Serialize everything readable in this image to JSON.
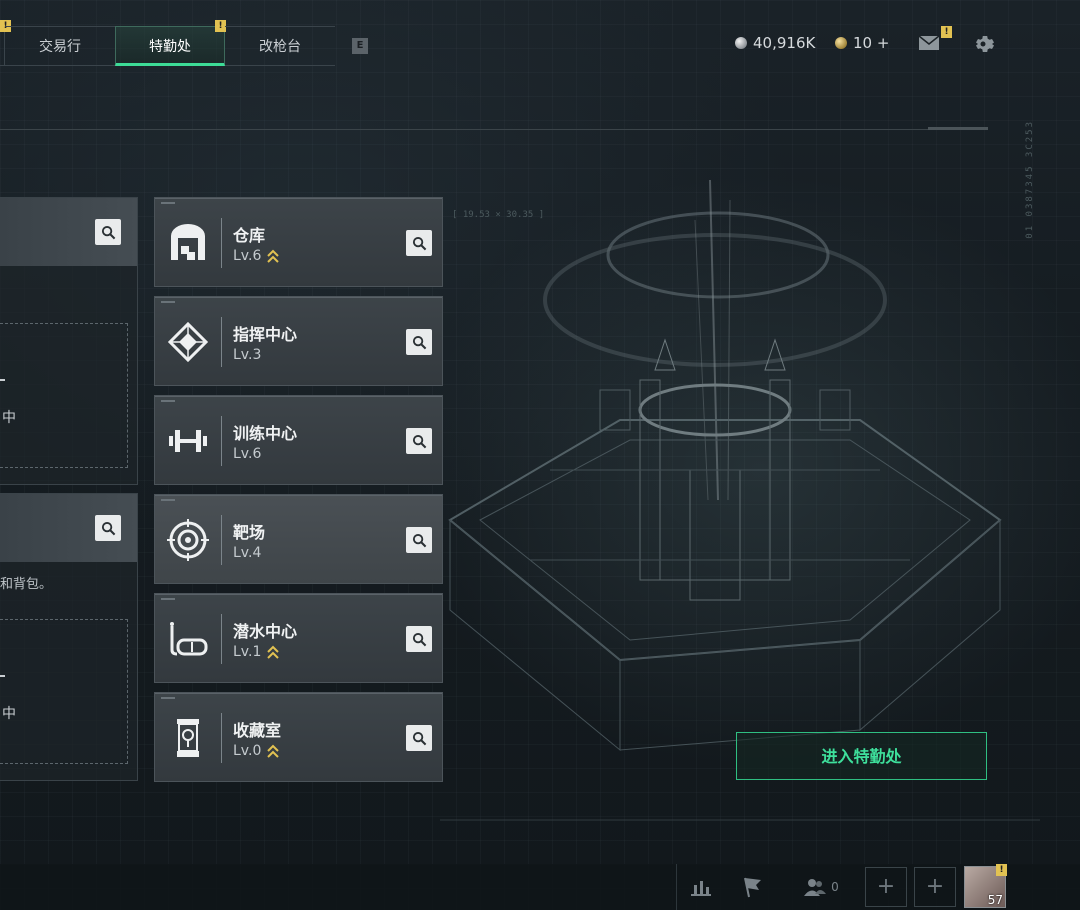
{
  "tabs": [
    {
      "label": "",
      "badge": "!"
    },
    {
      "label": "交易行",
      "badge": ""
    },
    {
      "label": "特勤处",
      "badge": "!",
      "active": true
    },
    {
      "label": "改枪台",
      "badge": ""
    }
  ],
  "key_hint": "E",
  "currency": {
    "silver": "40,916K",
    "gold": "10 +"
  },
  "mail_badge": "!",
  "left_cards": [
    {
      "slot_text": "中"
    },
    {
      "desc": "和背包。",
      "slot_text": "中"
    }
  ],
  "facilities": [
    {
      "name": "仓库",
      "level": "Lv.6",
      "upgradable": true,
      "icon": "warehouse-icon"
    },
    {
      "name": "指挥中心",
      "level": "Lv.3",
      "upgradable": false,
      "icon": "command-center-icon"
    },
    {
      "name": "训练中心",
      "level": "Lv.6",
      "upgradable": false,
      "icon": "dumbbell-icon"
    },
    {
      "name": "靶场",
      "level": "Lv.4",
      "upgradable": false,
      "icon": "target-icon",
      "selected": true
    },
    {
      "name": "潜水中心",
      "level": "Lv.1",
      "upgradable": true,
      "icon": "diving-mask-icon"
    },
    {
      "name": "收藏室",
      "level": "Lv.0",
      "upgradable": true,
      "icon": "collection-case-icon"
    }
  ],
  "coord_text": "[ 19.53 × 30.35 ]",
  "vert_text": "01 0387345 3C253",
  "enter_button": "进入特勤处",
  "bottom": {
    "friends_count": "0",
    "player_level": "57",
    "avatar_badge": "!"
  },
  "colors": {
    "accent": "#3ddc97",
    "badge": "#e2c252",
    "upgrade_arrow": "#e2c252"
  }
}
